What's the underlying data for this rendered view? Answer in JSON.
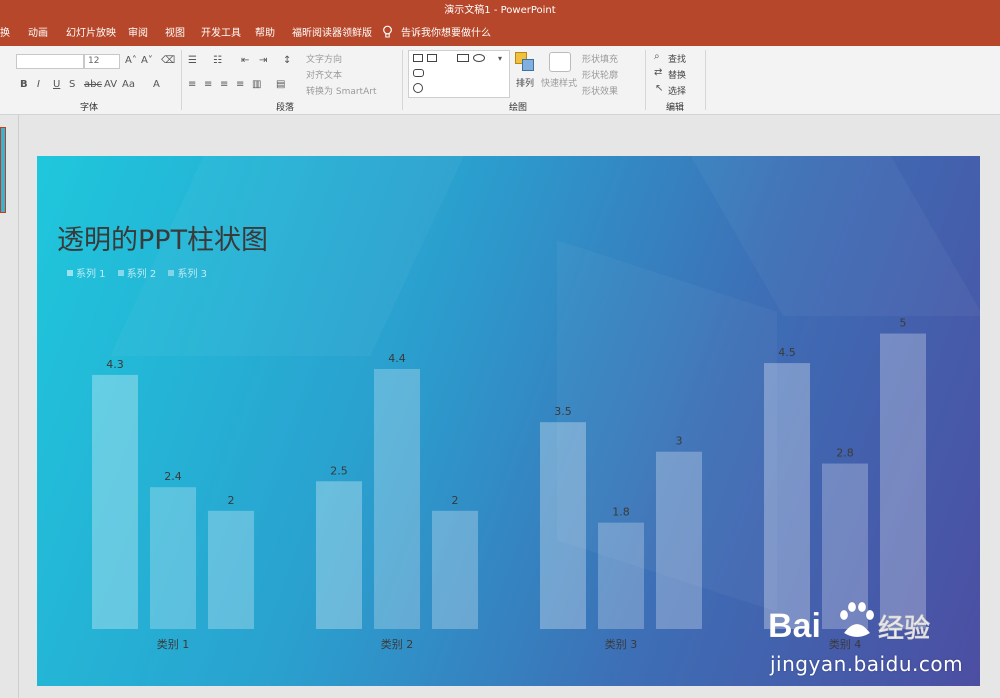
{
  "window": {
    "title": "演示文稿1  -  PowerPoint"
  },
  "tabs": [
    "换",
    "动画",
    "幻灯片放映",
    "审阅",
    "视图",
    "开发工具",
    "帮助",
    "福昕阅读器领鲜版"
  ],
  "tell_me": "告诉我你想要做什么",
  "ribbon": {
    "font_name": "",
    "font_size": "12",
    "groups": {
      "font": "字体",
      "paragraph": "段落",
      "drawing": "绘图",
      "editing": "编辑"
    },
    "text_direction": "文字方向",
    "align_text": "对齐文本",
    "convert_smartart": "转换为 SmartArt",
    "arrange": "排列",
    "quick_styles": "快速样式",
    "shape_fill": "形状填充",
    "shape_outline": "形状轮廓",
    "shape_effects": "形状效果",
    "find": "查找",
    "replace": "替换",
    "select": "选择"
  },
  "slide": {
    "title": "透明的PPT柱状图"
  },
  "chart_data": {
    "type": "bar",
    "title": "透明的PPT柱状图",
    "categories": [
      "类别 1",
      "类别 2",
      "类别 3",
      "类别 4"
    ],
    "series": [
      {
        "name": "系列 1",
        "values": [
          4.3,
          2.5,
          3.5,
          4.5
        ],
        "labels": [
          "4.3",
          "2.5",
          "3.5",
          "4.5"
        ]
      },
      {
        "name": "系列 2",
        "values": [
          2.4,
          4.4,
          1.8,
          2.8
        ],
        "labels": [
          "2.4",
          "4.4",
          "1.8",
          "2.8"
        ]
      },
      {
        "name": "系列 3",
        "values": [
          2,
          2,
          3,
          5
        ],
        "labels": [
          "2",
          "2",
          "3",
          "5"
        ]
      }
    ],
    "ylim": [
      0,
      5.5
    ],
    "grid": false,
    "legend_position": "top-left",
    "colors": [
      "#ffffff",
      "#ffffff",
      "#ffffff"
    ]
  },
  "watermark": {
    "text": "jingyan.baidu.com",
    "logo": "Bai du 经验"
  }
}
